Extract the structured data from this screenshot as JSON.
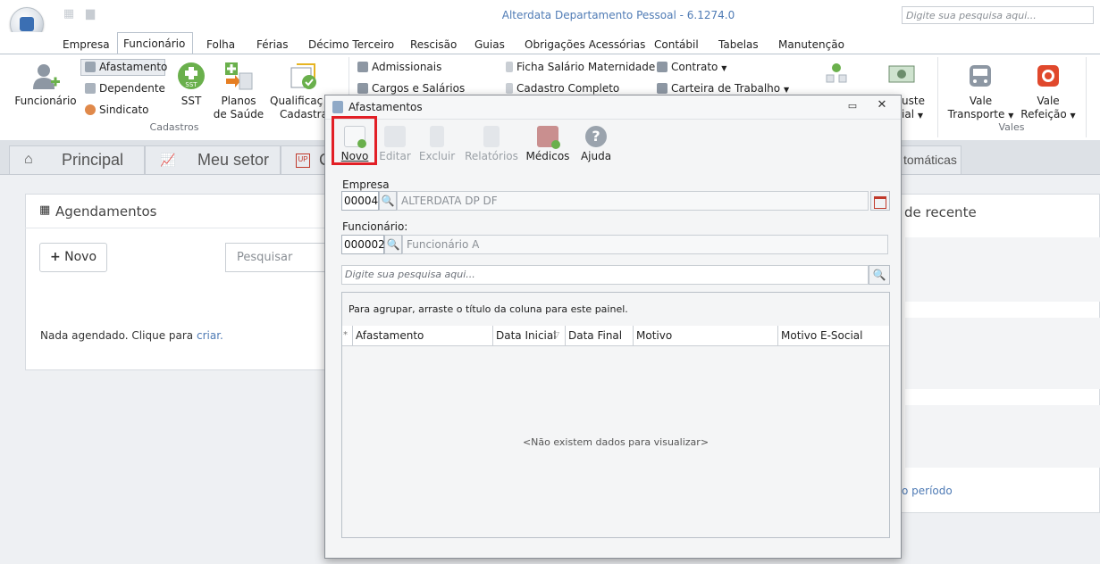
{
  "app": {
    "title": "Alterdata Departamento Pessoal - 6.1274.0",
    "search_placeholder": "Digite sua pesquisa aqui..."
  },
  "menu": {
    "tabs": [
      "Empresa",
      "Funcionário",
      "Folha",
      "Férias",
      "Décimo Terceiro",
      "Rescisão",
      "Guias",
      "Obrigações Acessórias",
      "Contábil",
      "Tabelas",
      "Manutenção"
    ],
    "active": "Funcionário"
  },
  "ribbon": {
    "funcionario": "Funcionário",
    "afastamento": "Afastamento",
    "dependente": "Dependente",
    "sindicato": "Sindicato",
    "sst": "SST",
    "planos": "Planos",
    "saude": "de Saúde",
    "qualificacao": "Qualificaç",
    "cadastral": "Cadastral",
    "group_cadastros": "Cadastros",
    "admissionais": "Admissionais",
    "cargos": "Cargos e Salários",
    "ficha": "Ficha Salário Maternidade",
    "cadastro_completo": "Cadastro Completo",
    "contrato": "Contrato",
    "carteira": "Carteira de Trabalho",
    "uste": "uste",
    "ial": "ial",
    "vale_transporte_1": "Vale",
    "vale_transporte_2": "Transporte",
    "vale_refeicao_1": "Vale",
    "vale_refeicao_2": "Refeição",
    "group_vales": "Vales"
  },
  "page_tabs": {
    "principal": "Principal",
    "meu_setor": "Meu setor",
    "partial": "C",
    "automaticas": "tomáticas"
  },
  "agendamentos": {
    "title": "Agendamentos",
    "novo": "Novo",
    "pesquisar": "Pesquisar",
    "empty_text": "Nada agendado. Clique para ",
    "empty_link": "criar."
  },
  "right_panel": {
    "title": "de recente",
    "link": "o período"
  },
  "dialog": {
    "title": "Afastamentos",
    "toolbar": {
      "novo": "Novo",
      "editar": "Editar",
      "excluir": "Excluir",
      "relatorios": "Relatórios",
      "medicos": "Médicos",
      "ajuda": "Ajuda"
    },
    "empresa_label": "Empresa",
    "empresa_code": "00004",
    "empresa_name": "ALTERDATA DP  DF",
    "funcionario_label": "Funcionário:",
    "funcionario_code": "000002",
    "funcionario_name": "Funcionário A",
    "search_placeholder": "Digite sua pesquisa aqui...",
    "group_hint": "Para agrupar, arraste o título da coluna para este painel.",
    "columns": [
      "Afastamento",
      "Data Inicial",
      "Data Final",
      "Motivo",
      "Motivo E-Social"
    ],
    "empty": "<Não existem dados para visualizar>"
  },
  "colors": {
    "accent": "#4f7bb5",
    "highlight": "#e21f26",
    "sst_green": "#6ab04c"
  }
}
